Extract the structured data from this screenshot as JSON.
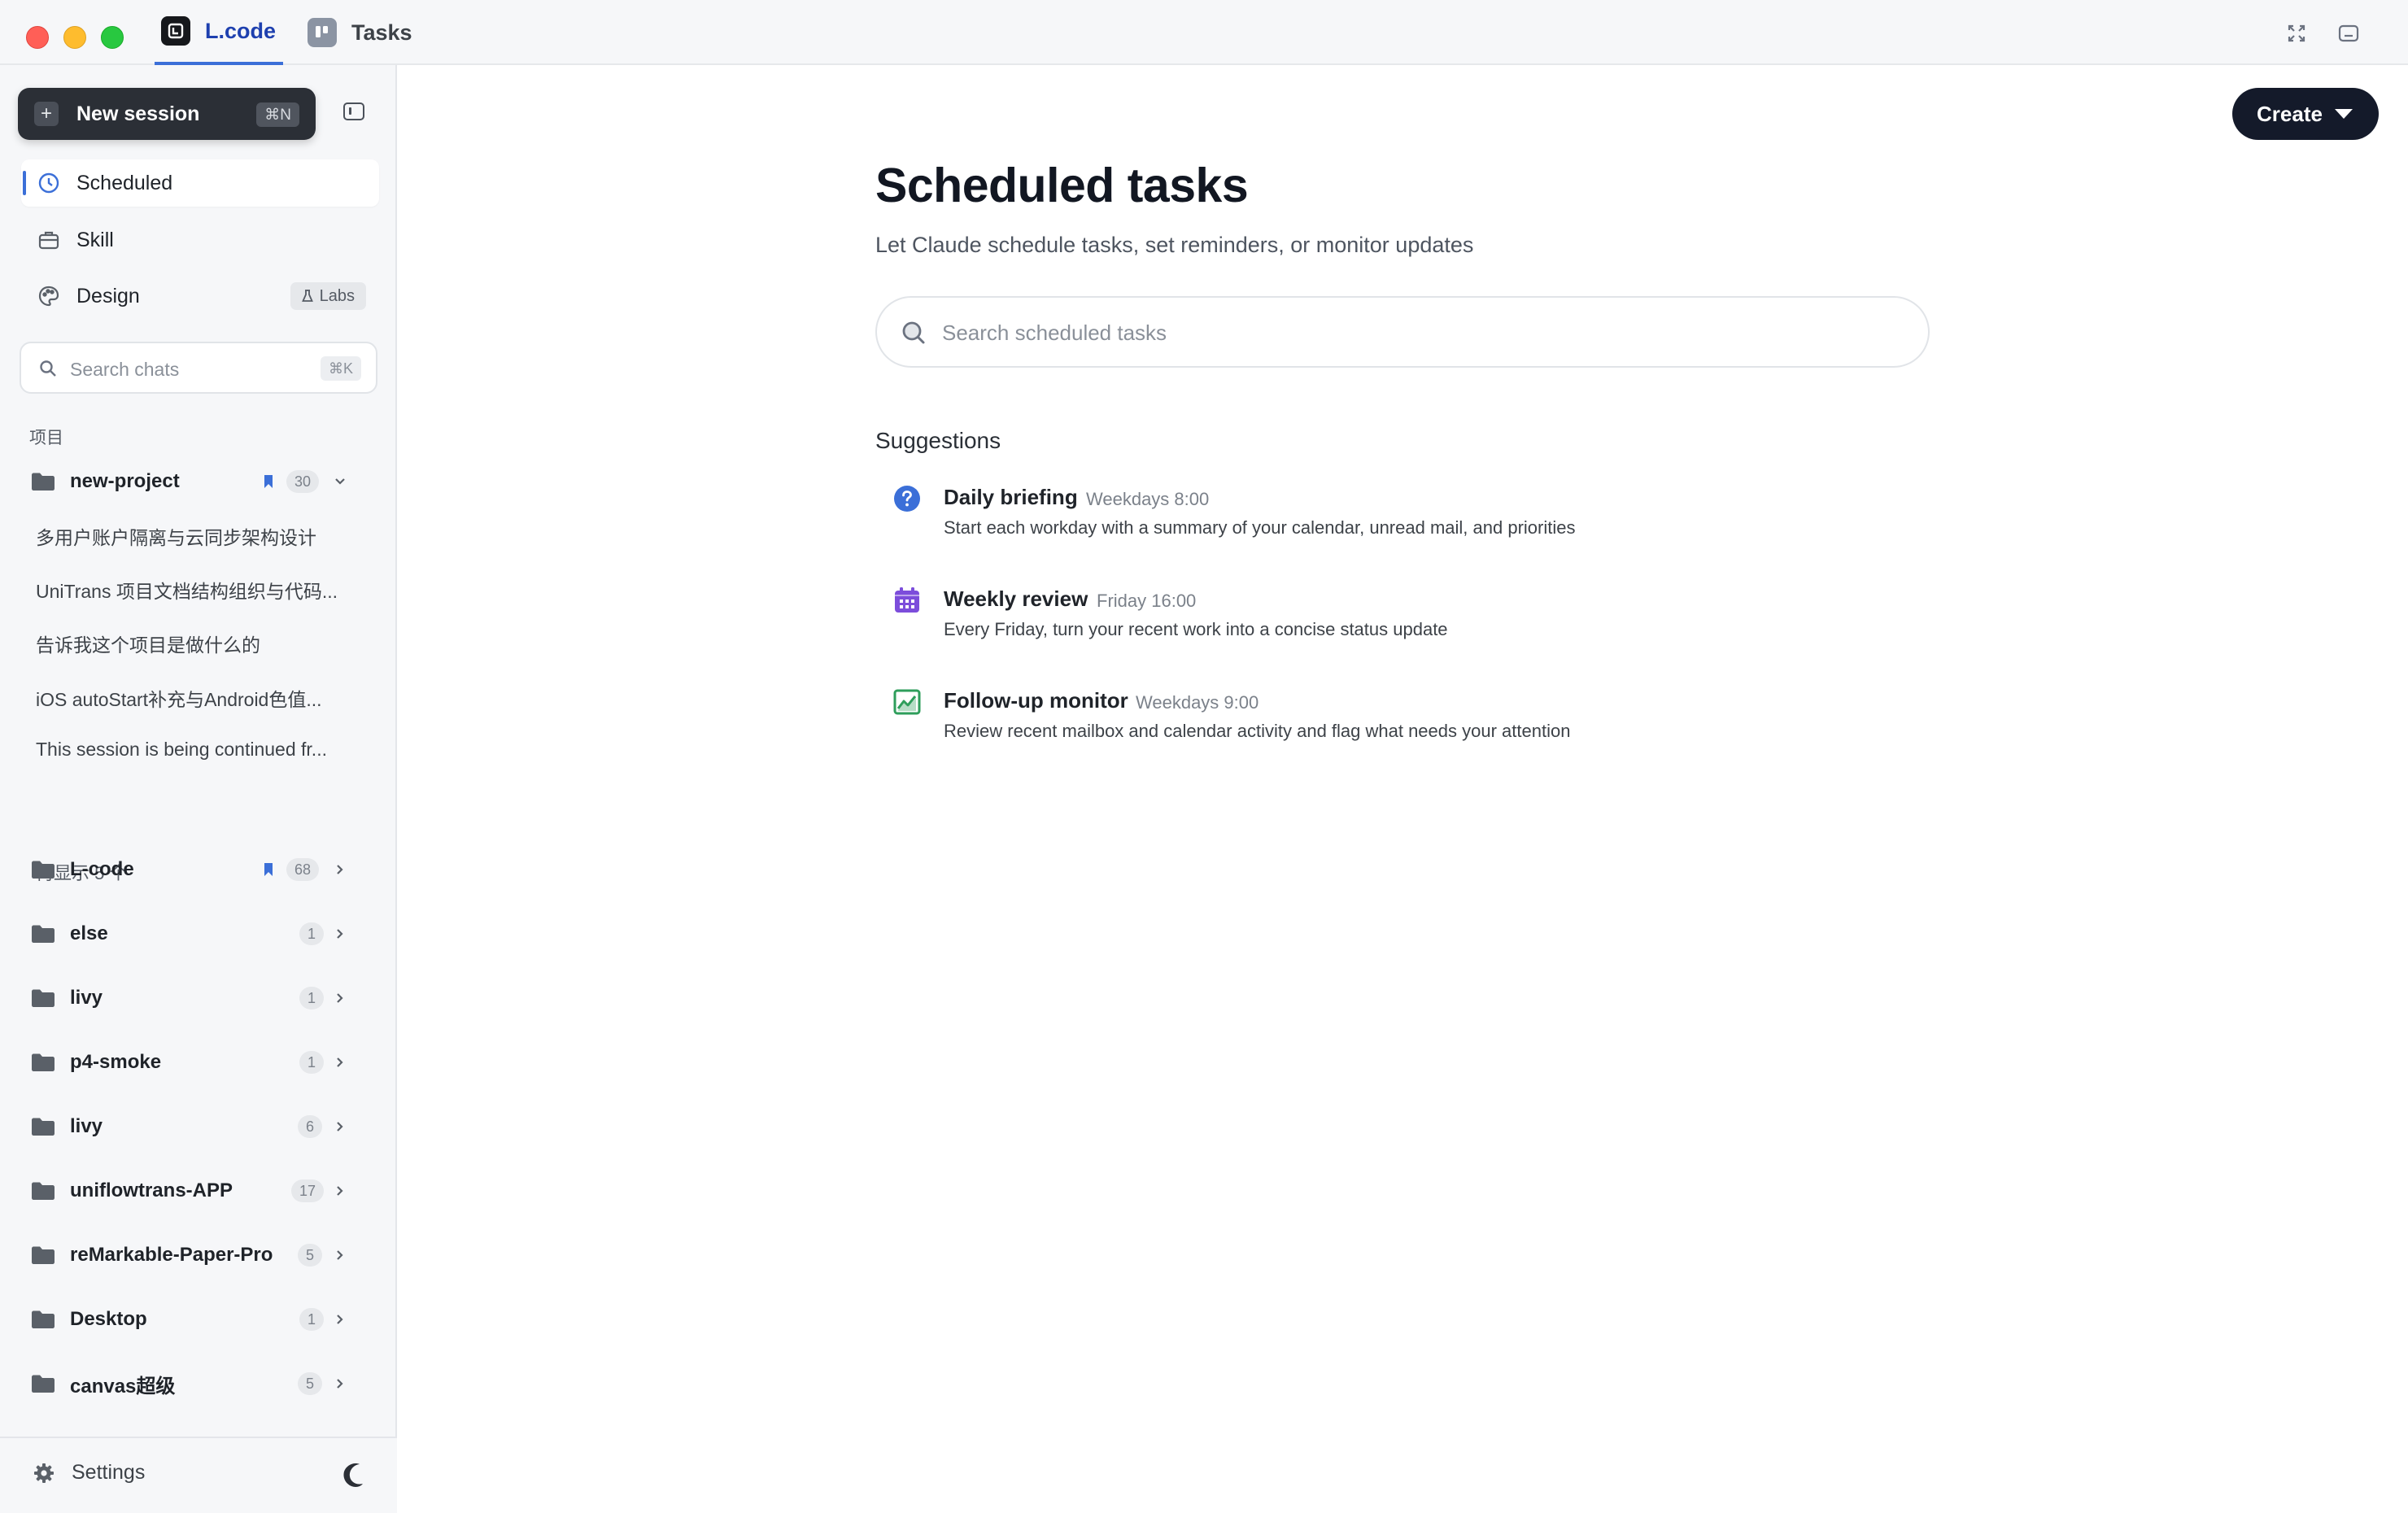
{
  "window": {
    "tabs": [
      {
        "label": "L.code",
        "icon": "lcode-app-icon",
        "active": true
      },
      {
        "label": "Tasks",
        "icon": "trello-board-icon",
        "active": false
      }
    ],
    "right_icons": [
      "fullscreen-icon",
      "sidebar-panel-icon"
    ]
  },
  "sidebar": {
    "new_session": {
      "label": "New session",
      "shortcut": "⌘N"
    },
    "nav": [
      {
        "label": "Scheduled",
        "icon": "clock-icon",
        "active": true
      },
      {
        "label": "Skill",
        "icon": "briefcase-icon",
        "active": false
      },
      {
        "label": "Design",
        "icon": "palette-icon",
        "active": false,
        "badge": "Labs"
      }
    ],
    "search": {
      "placeholder": "Search chats",
      "shortcut": "⌘K"
    },
    "projects_label": "项目",
    "expanded_project": {
      "name": "new-project",
      "count": "30",
      "bookmarked": true,
      "sessions": [
        "多用户账户隔离与云同步架构设计",
        "UniTrans 项目文档结构组织与代码...",
        "告诉我这个项目是做什么的",
        "iOS autoStart补充与Android色值...",
        "This session is being continued fr..."
      ],
      "show_more": "再显示 5 个"
    },
    "projects": [
      {
        "name": "L-code",
        "count": "68",
        "bookmarked": true
      },
      {
        "name": "else",
        "count": "1"
      },
      {
        "name": "livy",
        "count": "1"
      },
      {
        "name": "p4-smoke",
        "count": "1"
      },
      {
        "name": "livy",
        "count": "6"
      },
      {
        "name": "uniflowtrans-APP",
        "count": "17"
      },
      {
        "name": "reMarkable-Paper-Pro",
        "count": "5"
      },
      {
        "name": "Desktop",
        "count": "1"
      },
      {
        "name": "canvas超级",
        "count": "5"
      }
    ],
    "footer": {
      "settings_label": "Settings",
      "theme_icon": "moon-icon"
    }
  },
  "main": {
    "create_label": "Create",
    "title": "Scheduled tasks",
    "subtitle": "Let Claude schedule tasks, set reminders, or monitor updates",
    "search_placeholder": "Search scheduled tasks",
    "suggestions_title": "Suggestions",
    "suggestions": [
      {
        "title": "Daily briefing",
        "time": "Weekdays 8:00",
        "desc": "Start each workday with a summary of your calendar, unread mail, and priorities",
        "icon": "question-circle-icon",
        "color": "#3b6fd8"
      },
      {
        "title": "Weekly review",
        "time": "Friday 16:00",
        "desc": "Every Friday, turn your recent work into a concise status update",
        "icon": "calendar-icon",
        "color": "#7c4ddb"
      },
      {
        "title": "Follow-up monitor",
        "time": "Weekdays 9:00",
        "desc": "Review recent mailbox and calendar activity and flag what needs your attention",
        "icon": "chart-image-icon",
        "color": "#2e9e5b"
      }
    ]
  },
  "colors": {
    "accent": "#3b6fd8",
    "dark_button": "#141a2a",
    "sidebar_bg": "#f6f7f9"
  }
}
